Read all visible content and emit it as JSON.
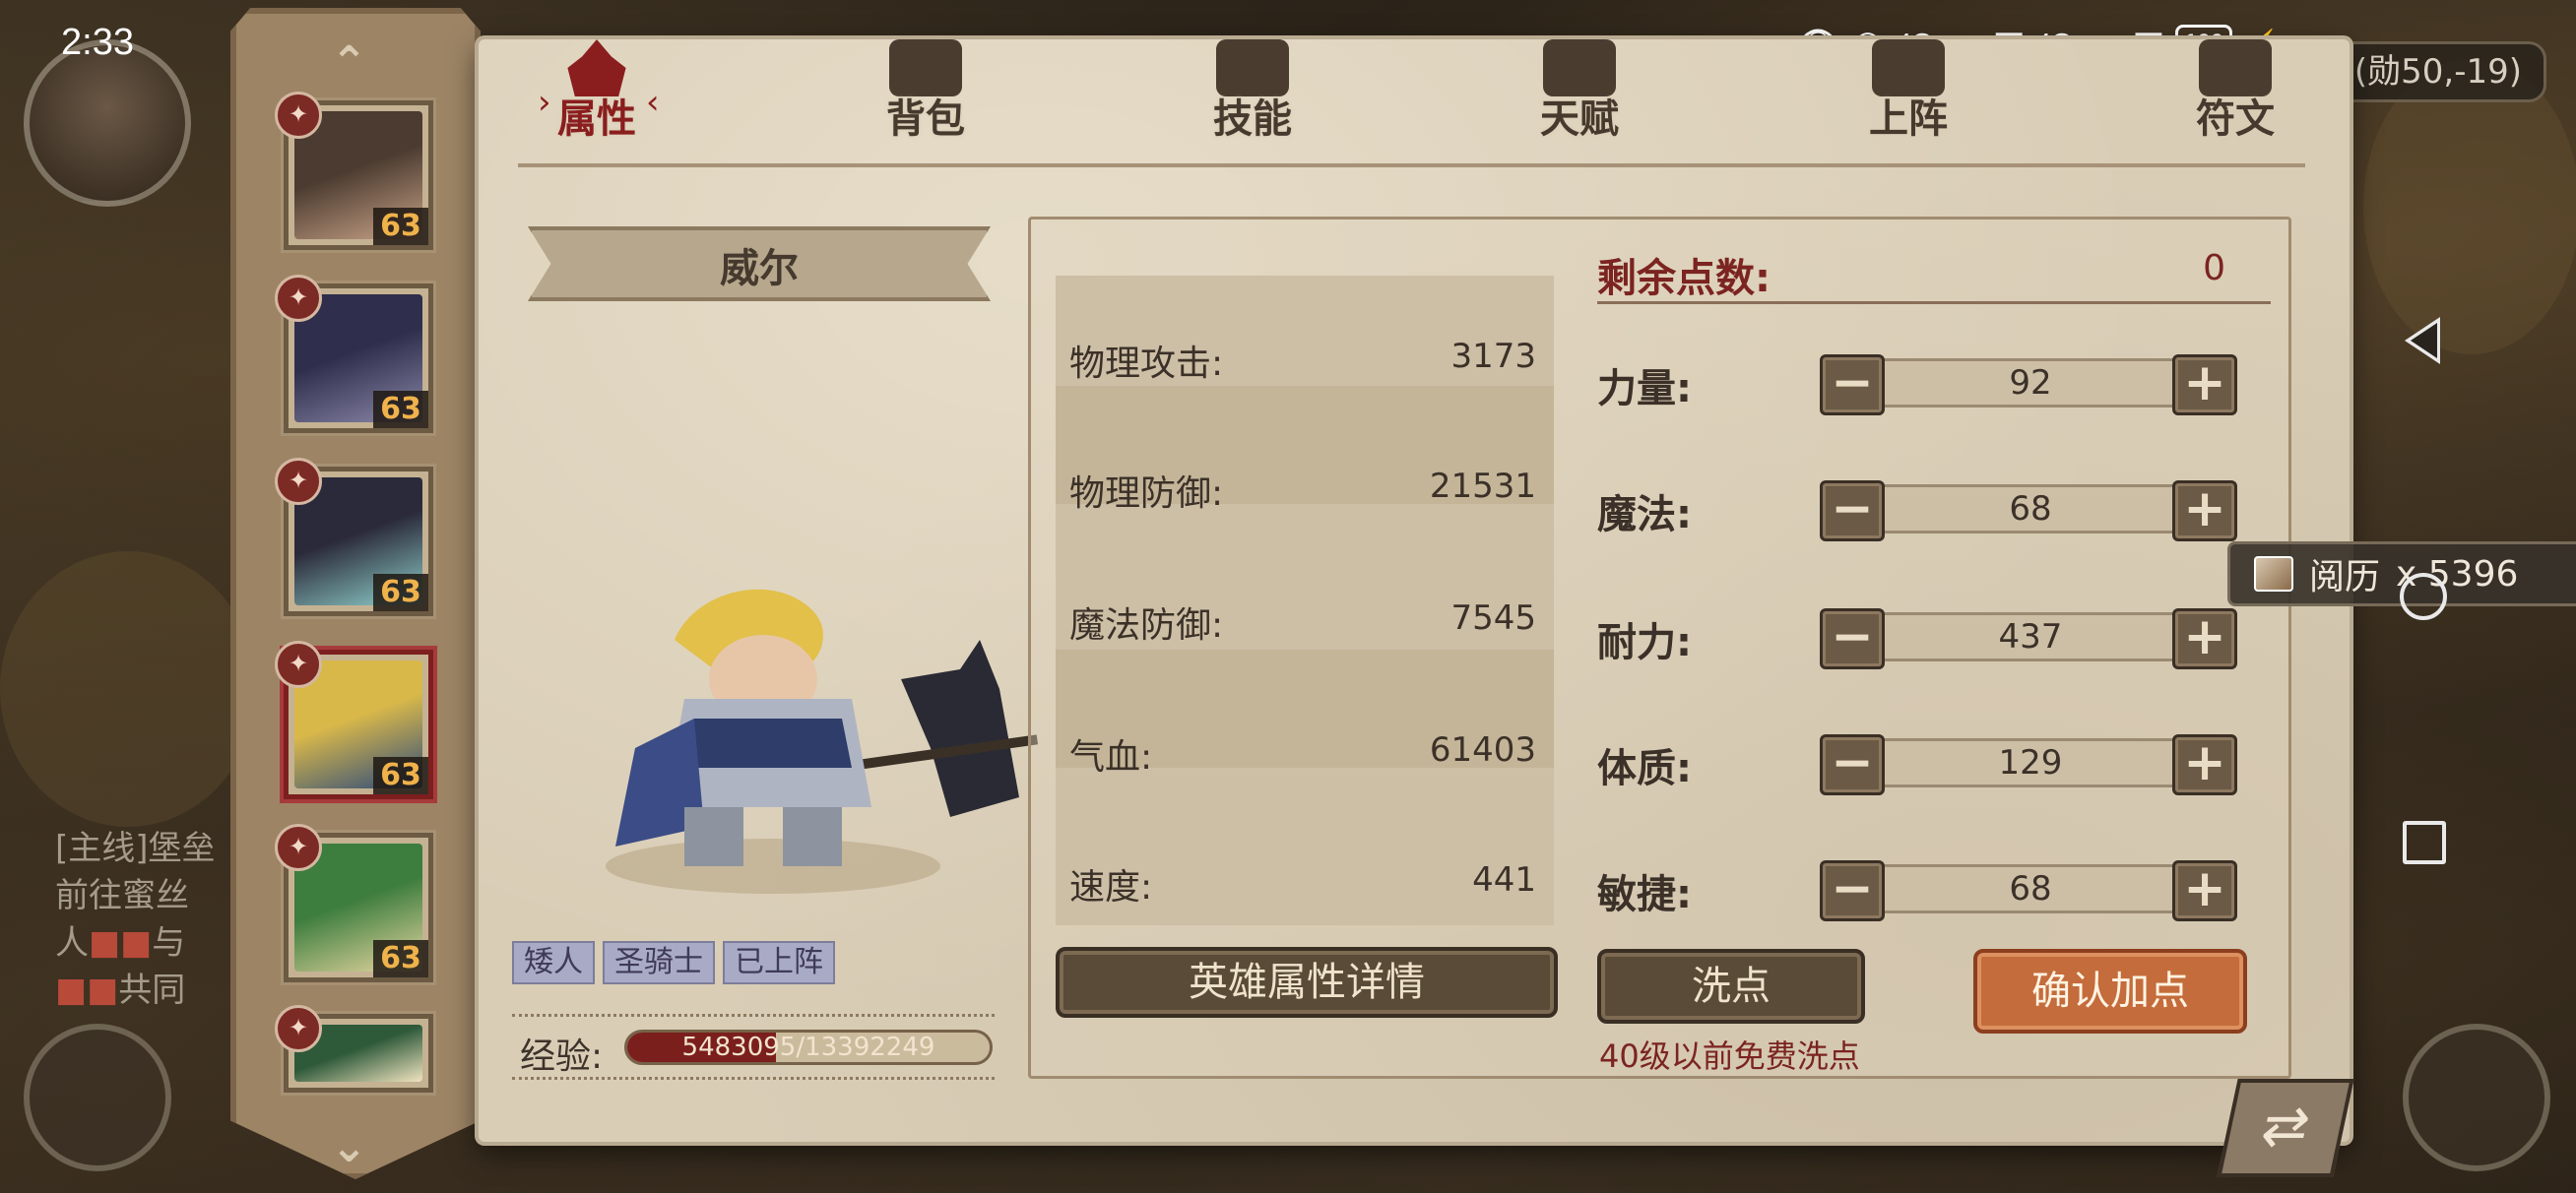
{
  "status_bar": {
    "time": "2:33",
    "network_1": "4G",
    "network_2": "4G",
    "battery": "100"
  },
  "map": {
    "coordinates": "(勋50,-19)"
  },
  "quest": {
    "line1": "[主线]堡垒",
    "line2": "前往蜜丝",
    "line3": "人",
    "line4": "与",
    "line5": "共同"
  },
  "toast": {
    "item": "阅历",
    "count": "x 5396"
  },
  "tabs": [
    {
      "label": "属性",
      "icon": "flame-icon",
      "active": true
    },
    {
      "label": "背包",
      "icon": "backpack-icon"
    },
    {
      "label": "技能",
      "icon": "book-icon"
    },
    {
      "label": "天赋",
      "icon": "eye-talent-icon"
    },
    {
      "label": "上阵",
      "icon": "crossed-swords-icon"
    },
    {
      "label": "符文",
      "icon": "rune-icon"
    }
  ],
  "heroes": [
    {
      "level": "63",
      "badge": "weapon",
      "colors": [
        "#4b3b30",
        "#c9a387"
      ]
    },
    {
      "level": "63",
      "badge": "weapon",
      "colors": [
        "#2f2e4c",
        "#8a87a8"
      ]
    },
    {
      "level": "63",
      "badge": "holy",
      "colors": [
        "#2b2a3a",
        "#8fd0cc"
      ]
    },
    {
      "level": "63",
      "badge": "weapon",
      "colors": [
        "#d9b84a",
        "#2c4a7a"
      ]
    },
    {
      "level": "63",
      "badge": "weapon",
      "colors": [
        "#3d7d3e",
        "#e6d7a0"
      ]
    },
    {
      "level": "",
      "badge": "staff",
      "colors": [
        "#2e5a3a",
        "#f0e4c0"
      ]
    }
  ],
  "hero": {
    "name": "威尔",
    "tags": [
      "矮人",
      "圣骑士",
      "已上阵"
    ],
    "exp_label": "经验:",
    "exp_text": "5483095/13392249",
    "exp_fraction": 0.41
  },
  "stats": [
    {
      "name": "物理攻击:",
      "value": "3173"
    },
    {
      "name": "物理防御:",
      "value": "21531"
    },
    {
      "name": "魔法防御:",
      "value": "7545"
    },
    {
      "name": "气血:",
      "value": "61403"
    },
    {
      "name": "速度:",
      "value": "441"
    }
  ],
  "points": {
    "label": "剩余点数:",
    "value": "0"
  },
  "attributes": [
    {
      "name": "力量:",
      "value": "92"
    },
    {
      "name": "魔法:",
      "value": "68"
    },
    {
      "name": "耐力:",
      "value": "437"
    },
    {
      "name": "体质:",
      "value": "129"
    },
    {
      "name": "敏捷:",
      "value": "68"
    }
  ],
  "buttons": {
    "detail": "英雄属性详情",
    "wash": "洗点",
    "wash_note": "40级以前免费洗点",
    "confirm": "确认加点",
    "minus": "−",
    "plus": "+"
  },
  "colors": {
    "accent_red": "#7b2421",
    "parchment": "#d9cdb6",
    "confirm": "#c46c3c"
  }
}
